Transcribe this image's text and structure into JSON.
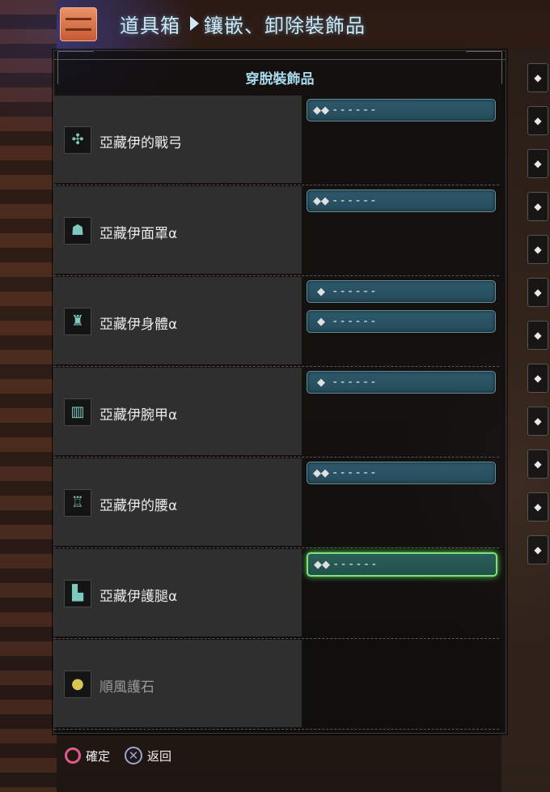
{
  "header": {
    "section": "道具箱",
    "page": "鑲嵌、卸除裝飾品"
  },
  "panel": {
    "title": "穿脫裝飾品"
  },
  "equipment": [
    {
      "name": "亞藏伊的戰弓",
      "icon": "bow-icon",
      "slots": [
        {
          "icon": "gem-lv3-icon",
          "text": "------"
        }
      ]
    },
    {
      "name": "亞藏伊面罩α",
      "icon": "helm-icon",
      "slots": [
        {
          "icon": "gem-lv3-icon",
          "text": "------"
        }
      ]
    },
    {
      "name": "亞藏伊身體α",
      "icon": "chest-icon",
      "slots": [
        {
          "icon": "gem-lv1-icon",
          "text": "------"
        },
        {
          "icon": "gem-lv1-icon",
          "text": "------"
        }
      ]
    },
    {
      "name": "亞藏伊腕甲α",
      "icon": "arms-icon",
      "slots": [
        {
          "icon": "gem-lv1-icon",
          "text": "------"
        }
      ]
    },
    {
      "name": "亞藏伊的腰α",
      "icon": "waist-icon",
      "slots": [
        {
          "icon": "gem-lv3-icon",
          "text": "------"
        }
      ]
    },
    {
      "name": "亞藏伊護腿α",
      "icon": "legs-icon",
      "slots": [
        {
          "icon": "gem-lv3-icon",
          "text": "------",
          "selected": true
        }
      ]
    },
    {
      "name": "順風護石",
      "icon": "charm-icon",
      "dim": true,
      "slots": []
    }
  ],
  "footer": {
    "confirm": "確定",
    "back": "返回"
  },
  "colors": {
    "slot_bg": "#2d5a6c",
    "slot_selected_border": "#7de37a",
    "title": "#a9dcef",
    "circle_button": "#e05a8c"
  }
}
